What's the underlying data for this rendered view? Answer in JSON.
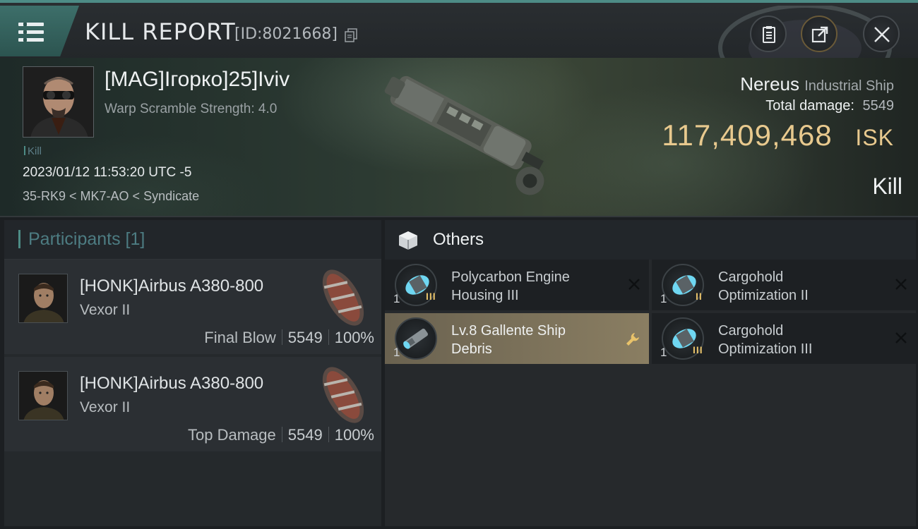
{
  "header": {
    "title": "KILL REPORT",
    "report_id": "[ID:8021668]"
  },
  "victim": {
    "name": "[MAG]Iгорко]25]Iviv",
    "warp_scramble": "Warp Scramble Strength: 4.0",
    "kill_tag": "Kill",
    "time": "2023/01/12 11:53:20 UTC -5",
    "location": "35-RK9 < MK7-AO < Syndicate",
    "ship_name": "Nereus",
    "ship_class": "Industrial Ship",
    "total_damage_label": "Total damage:",
    "total_damage_value": "5549",
    "isk_value": "117,409,468",
    "isk_unit": "ISK",
    "result": "Kill"
  },
  "participants": {
    "title": "Participants [1]",
    "rows": [
      {
        "name": "[HONK]Airbus A380-800",
        "ship": "Vexor II",
        "role": "Final Blow",
        "damage": "5549",
        "percent": "100%"
      },
      {
        "name": "[HONK]Airbus A380-800",
        "ship": "Vexor II",
        "role": "Top Damage",
        "damage": "5549",
        "percent": "100%"
      }
    ]
  },
  "others": {
    "title": "Others",
    "items": [
      {
        "name": "Polycarbon Engine Housing III",
        "line1": "Polycarbon Engine",
        "line2": "Housing III",
        "qty": "1",
        "rank": "III",
        "action_icon": "close-icon"
      },
      {
        "name": "Cargohold Optimization II",
        "line1": "Cargohold",
        "line2": "Optimization II",
        "qty": "1",
        "rank": "II",
        "action_icon": "close-icon"
      },
      {
        "name": "Lv.8 Gallente Ship Debris",
        "line1": "Lv.8 Gallente Ship",
        "line2": "Debris",
        "qty": "1",
        "rank": "",
        "action_icon": "wrench-icon"
      },
      {
        "name": "Cargohold Optimization III",
        "line1": "Cargohold",
        "line2": "Optimization III",
        "qty": "1",
        "rank": "III",
        "action_icon": "close-icon"
      }
    ]
  },
  "colors": {
    "accent_teal": "#4d8c86",
    "isk_gold": "#e8c98e",
    "rank_gold": "#e8c26a",
    "selected_item": "#8a7e62"
  }
}
